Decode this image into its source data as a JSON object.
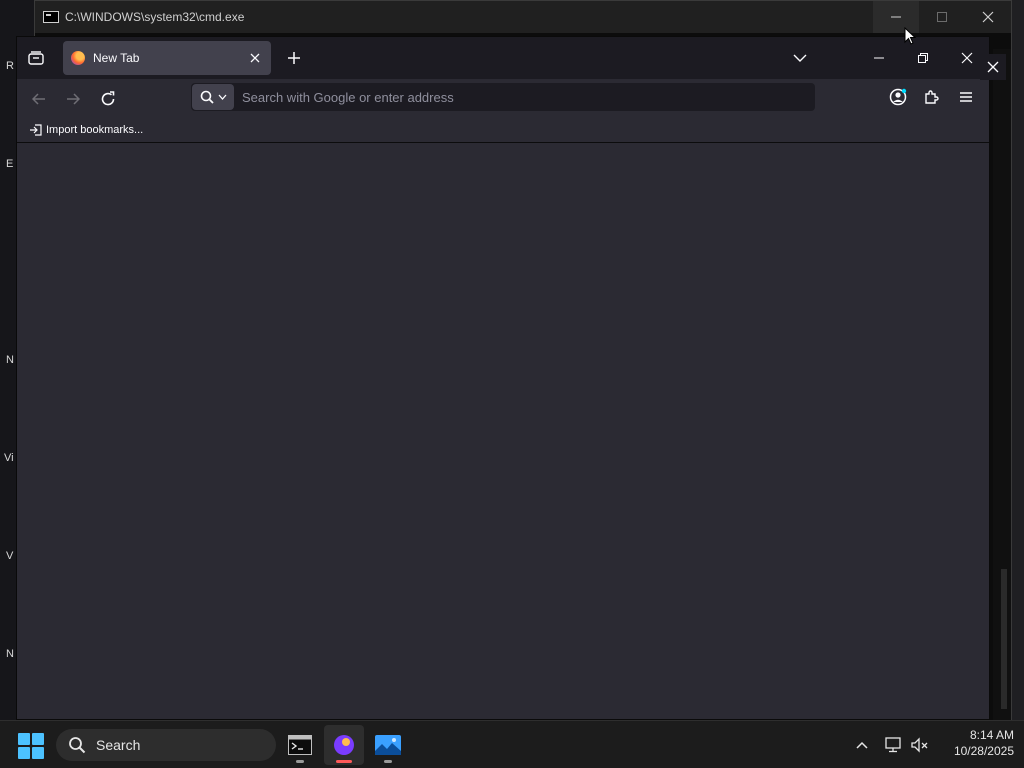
{
  "cmd": {
    "title": "C:\\WINDOWS\\system32\\cmd.exe"
  },
  "firefox": {
    "tab": {
      "title": "New Tab"
    },
    "urlbar": {
      "placeholder": "Search with Google or enter address"
    },
    "bookmarks": {
      "import_label": "Import bookmarks..."
    }
  },
  "taskbar": {
    "search_label": "Search",
    "apps": [
      "command-prompt",
      "firefox",
      "photos"
    ],
    "clock": {
      "time": "8:14 AM",
      "date": "10/28/2025"
    }
  },
  "desktop_fragments": [
    "R",
    "E",
    "N",
    "Vi",
    "V",
    "N"
  ],
  "colors": {
    "accent": "#4cc2ff",
    "firefox_active_indicator": "#ff5a5a",
    "chrome_dark": "#1c1b22",
    "content_bg": "#2b2a33"
  }
}
